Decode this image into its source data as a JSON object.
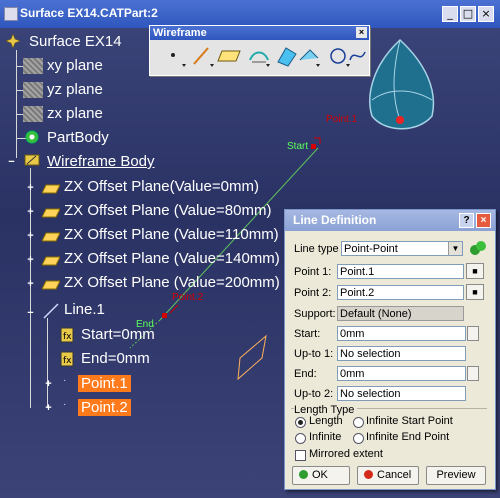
{
  "window": {
    "title": "Surface EX14.CATPart:2",
    "minimize": "_",
    "maximize": "□",
    "close": "×"
  },
  "tree": {
    "root": "Surface EX14",
    "planes": [
      "xy plane",
      "yz plane",
      "zx plane"
    ],
    "partbody": "PartBody",
    "wireframe_body": "Wireframe Body",
    "offset_planes": [
      "ZX Offset Plane(Value=0mm)",
      "ZX Offset Plane (Value=80mm)",
      "ZX Offset Plane (Value=110mm)",
      "ZX Offset Plane (Value=140mm)",
      "ZX Offset Plane (Value=200mm)"
    ],
    "line": "Line.1",
    "line_start": "Start=0mm",
    "line_end": "End=0mm",
    "point1": "Point.1",
    "point2": "Point.2"
  },
  "toolbar": {
    "title": "Wireframe",
    "close": "×"
  },
  "geometry": {
    "point1_label": "Point.1",
    "point2_label": "Point.2",
    "start_label": "Start",
    "end_label": "End"
  },
  "dialog": {
    "title": "Line Definition",
    "help": "?",
    "close": "×",
    "line_type_label": "Line type :",
    "line_type_value": "Point-Point",
    "point1_label": "Point 1:",
    "point1_value": "Point.1",
    "point2_label": "Point 2:",
    "point2_value": "Point.2",
    "support_label": "Support:",
    "support_value": "Default (None)",
    "start_label": "Start:",
    "start_value": "0mm",
    "upto1_label": "Up-to 1:",
    "upto1_value": "No selection",
    "end_label": "End:",
    "end_value": "0mm",
    "upto2_label": "Up-to 2:",
    "upto2_value": "No selection",
    "length_type_label": "Length Type",
    "opt_length": "Length",
    "opt_infinite_start": "Infinite Start Point",
    "opt_infinite": "Infinite",
    "opt_infinite_end": "Infinite End Point",
    "mirrored": "Mirrored extent",
    "ok": "OK",
    "cancel": "Cancel",
    "preview": "Preview"
  }
}
